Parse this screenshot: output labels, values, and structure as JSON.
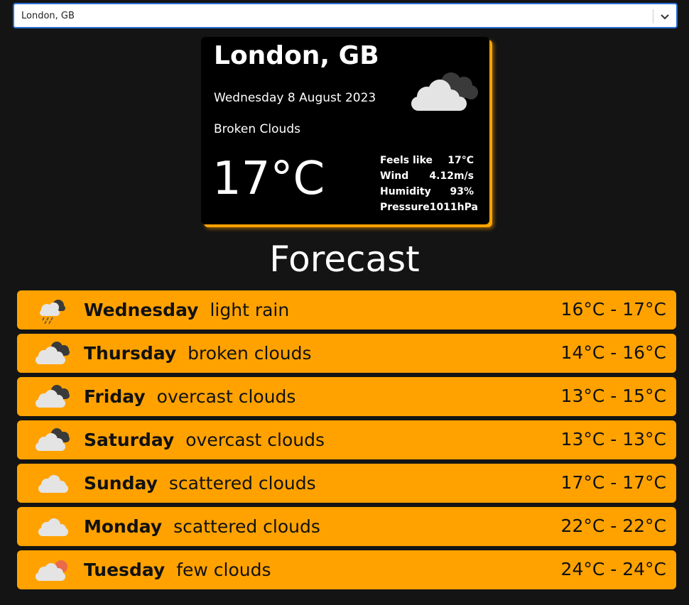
{
  "search": {
    "value": "London, GB"
  },
  "current": {
    "city": "London, GB",
    "date": "Wednesday 8 August 2023",
    "description": "Broken Clouds",
    "temperature": "17°C",
    "icon": "broken-clouds-icon",
    "details": [
      {
        "label": "Feels like",
        "value": "17°C"
      },
      {
        "label": "Wind",
        "value": "4.12m/s"
      },
      {
        "label": "Humidity",
        "value": "93%"
      },
      {
        "label": "Pressure",
        "value": "1011hPa"
      }
    ]
  },
  "forecast": {
    "heading": "Forecast",
    "days": [
      {
        "day": "Wednesday",
        "description": "light rain",
        "range": "16°C - 17°C",
        "icon": "rain-icon"
      },
      {
        "day": "Thursday",
        "description": "broken clouds",
        "range": "14°C - 16°C",
        "icon": "broken-clouds-icon"
      },
      {
        "day": "Friday",
        "description": "overcast clouds",
        "range": "13°C - 15°C",
        "icon": "broken-clouds-icon"
      },
      {
        "day": "Saturday",
        "description": "overcast clouds",
        "range": "13°C - 13°C",
        "icon": "broken-clouds-icon"
      },
      {
        "day": "Sunday",
        "description": "scattered clouds",
        "range": "17°C - 17°C",
        "icon": "scattered-clouds-icon"
      },
      {
        "day": "Monday",
        "description": "scattered clouds",
        "range": "22°C - 22°C",
        "icon": "scattered-clouds-icon"
      },
      {
        "day": "Tuesday",
        "description": "few clouds",
        "range": "24°C - 24°C",
        "icon": "few-clouds-icon"
      }
    ]
  },
  "colors": {
    "background": "#141414",
    "accent": "#ffa200",
    "card": "#000000",
    "select_border": "#2a6fd4"
  }
}
